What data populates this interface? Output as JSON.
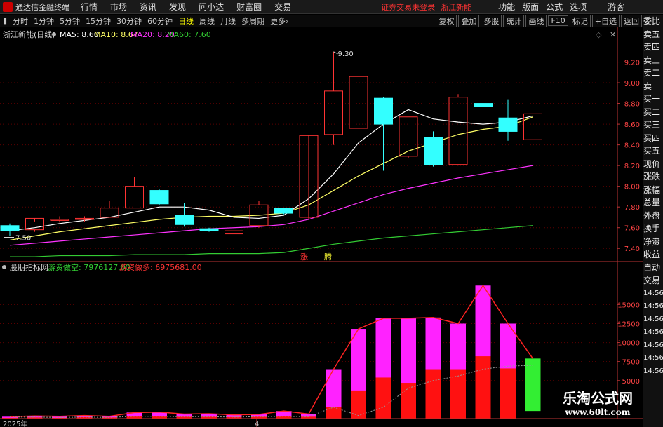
{
  "app": {
    "title": "通达信金融终端"
  },
  "menu": [
    "行情",
    "市场",
    "资讯",
    "发现",
    "问小达",
    "财富圈",
    "交易"
  ],
  "menu_right": {
    "warning": "证券交易未登录",
    "stock": "浙江新能",
    "items": [
      "功能",
      "版面",
      "公式",
      "选项"
    ],
    "guest": "游客"
  },
  "periods": [
    "分时",
    "1分钟",
    "5分钟",
    "15分钟",
    "30分钟",
    "60分钟",
    "日线",
    "周线",
    "月线",
    "多周期",
    "更多"
  ],
  "active_period": "日线",
  "more_arrow": "›",
  "toolbar_right": [
    "复权",
    "叠加",
    "多股",
    "统计",
    "画线",
    "F10",
    "标记",
    "+自选",
    "返回"
  ],
  "main_panel": {
    "stock_label": "浙江新能(日线)",
    "ma": [
      {
        "label": "MA5: 8.60",
        "color": "#ffffff"
      },
      {
        "label": "MA10: 8.67",
        "color": "#ffff66"
      },
      {
        "label": "MA20: 8.20",
        "color": "#ff33ff"
      },
      {
        "label": "MA60: 7.60",
        "color": "#33cc33"
      }
    ],
    "high_label": "9.30",
    "low_label": "7.50",
    "signal_labels": [
      "涨",
      "腾"
    ]
  },
  "sub_panel": {
    "name": "股朋指标网",
    "lines": [
      {
        "label": "游资做空: 7976127.00",
        "color": "#33cc33"
      },
      {
        "label": "游资做多: 6975681.00",
        "color": "#ff3333"
      }
    ]
  },
  "right_strip": [
    "委比",
    "卖五",
    "卖四",
    "卖三",
    "卖二",
    "卖一",
    "买一",
    "买二",
    "买三",
    "买四",
    "买五",
    "现价",
    "涨跌",
    "涨幅",
    "总量",
    "外盘",
    "换手",
    "净资",
    "收益",
    "自动",
    "交易",
    "14:56",
    "14:56",
    "14:56",
    "14:56",
    "14:56",
    "14:56",
    "14:56"
  ],
  "x_labels": [
    "2025年",
    "4"
  ],
  "watermark": {
    "line1": "乐淘公式网",
    "line2": "www.60lt.com"
  },
  "colors": {
    "up": "#ff3333",
    "down": "#33ffff",
    "ma5": "#ffffff",
    "ma10": "#ffff66",
    "ma20": "#ff33ff",
    "ma60": "#33cc33",
    "grid": "#5a0000",
    "axis": "#bb3333"
  },
  "chart_data": [
    {
      "type": "candlestick",
      "title": "浙江新能(日线)",
      "yticks": [
        7.4,
        7.6,
        7.8,
        8.0,
        8.2,
        8.4,
        8.6,
        8.8,
        9.0,
        9.2
      ],
      "ylim": [
        7.3,
        9.4
      ],
      "candles": [
        {
          "o": 7.62,
          "h": 7.64,
          "l": 7.52,
          "c": 7.57
        },
        {
          "o": 7.58,
          "h": 7.66,
          "l": 7.56,
          "c": 7.69
        },
        {
          "o": 7.67,
          "h": 7.71,
          "l": 7.65,
          "c": 7.68
        },
        {
          "o": 7.68,
          "h": 7.71,
          "l": 7.66,
          "c": 7.69
        },
        {
          "o": 7.7,
          "h": 7.86,
          "l": 7.7,
          "c": 7.79
        },
        {
          "o": 7.79,
          "h": 8.09,
          "l": 7.79,
          "c": 8.0
        },
        {
          "o": 7.96,
          "h": 7.97,
          "l": 7.82,
          "c": 7.83
        },
        {
          "o": 7.72,
          "h": 7.84,
          "l": 7.61,
          "c": 7.63
        },
        {
          "o": 7.59,
          "h": 7.6,
          "l": 7.56,
          "c": 7.57
        },
        {
          "o": 7.54,
          "h": 7.57,
          "l": 7.52,
          "c": 7.57
        },
        {
          "o": 7.62,
          "h": 7.86,
          "l": 7.6,
          "c": 7.82
        },
        {
          "o": 7.79,
          "h": 7.79,
          "l": 7.73,
          "c": 7.74
        },
        {
          "o": 7.7,
          "h": 7.7,
          "l": 7.68,
          "c": 8.49
        },
        {
          "o": 8.5,
          "h": 9.3,
          "l": 8.4,
          "c": 8.92
        },
        {
          "o": 8.56,
          "h": 9.06,
          "l": 8.56,
          "c": 9.06
        },
        {
          "o": 8.85,
          "h": 8.86,
          "l": 8.15,
          "c": 8.6
        },
        {
          "o": 8.29,
          "h": 8.67,
          "l": 8.27,
          "c": 8.67
        },
        {
          "o": 8.47,
          "h": 8.53,
          "l": 8.19,
          "c": 8.21
        },
        {
          "o": 8.21,
          "h": 8.89,
          "l": 8.2,
          "c": 8.86
        },
        {
          "o": 8.8,
          "h": 8.8,
          "l": 8.55,
          "c": 8.77
        },
        {
          "o": 8.66,
          "h": 8.84,
          "l": 8.44,
          "c": 8.53
        },
        {
          "o": 8.45,
          "h": 8.88,
          "l": 8.31,
          "c": 8.7
        }
      ],
      "ma5": [
        7.57,
        7.6,
        7.64,
        7.67,
        7.7,
        7.75,
        7.8,
        7.8,
        7.77,
        7.7,
        7.69,
        7.72,
        7.88,
        8.12,
        8.42,
        8.6,
        8.74,
        8.65,
        8.62,
        8.6,
        8.62,
        8.68
      ],
      "ma10": [
        7.48,
        7.52,
        7.56,
        7.59,
        7.62,
        7.65,
        7.68,
        7.7,
        7.71,
        7.71,
        7.72,
        7.74,
        7.82,
        7.96,
        8.1,
        8.22,
        8.34,
        8.42,
        8.5,
        8.55,
        8.58,
        8.67
      ],
      "ma20": [
        7.43,
        7.45,
        7.47,
        7.49,
        7.51,
        7.53,
        7.55,
        7.57,
        7.59,
        7.6,
        7.61,
        7.63,
        7.68,
        7.76,
        7.84,
        7.92,
        7.98,
        8.03,
        8.08,
        8.12,
        8.16,
        8.2
      ],
      "ma60": [
        7.32,
        7.32,
        7.33,
        7.33,
        7.33,
        7.34,
        7.34,
        7.34,
        7.35,
        7.35,
        7.35,
        7.36,
        7.4,
        7.44,
        7.47,
        7.5,
        7.52,
        7.54,
        7.56,
        7.58,
        7.6,
        7.62
      ]
    },
    {
      "type": "bar",
      "title": "股朋指标网",
      "yticks": [
        5000,
        7500,
        10000,
        12500,
        15000
      ],
      "ylim": [
        0,
        19000
      ],
      "total": [
        250,
        350,
        300,
        400,
        300,
        800,
        850,
        600,
        650,
        500,
        550,
        1000,
        600,
        6500,
        11800,
        13200,
        13200,
        13300,
        12500,
        17500,
        12500,
        7900
      ],
      "red": [
        100,
        150,
        100,
        200,
        150,
        300,
        300,
        250,
        250,
        200,
        250,
        300,
        250,
        1500,
        3700,
        5400,
        4700,
        6500,
        6500,
        8200,
        6600,
        7900
      ],
      "bar_colors": [
        "m",
        "m",
        "m",
        "m",
        "m",
        "m",
        "m",
        "m",
        "m",
        "m",
        "m",
        "m",
        "m",
        "m",
        "m",
        "m",
        "m",
        "m",
        "m",
        "m",
        "m",
        "g"
      ],
      "upper_line": [
        250,
        350,
        300,
        400,
        300,
        800,
        850,
        600,
        650,
        500,
        550,
        1000,
        600,
        6500,
        11800,
        13200,
        13200,
        13300,
        12500,
        17500,
        12500,
        7900
      ],
      "lower_line": [
        200,
        200,
        150,
        200,
        150,
        300,
        300,
        250,
        250,
        200,
        250,
        300,
        250,
        1500,
        400,
        1500,
        4000,
        5000,
        5600,
        6500,
        6900,
        7000
      ]
    }
  ]
}
